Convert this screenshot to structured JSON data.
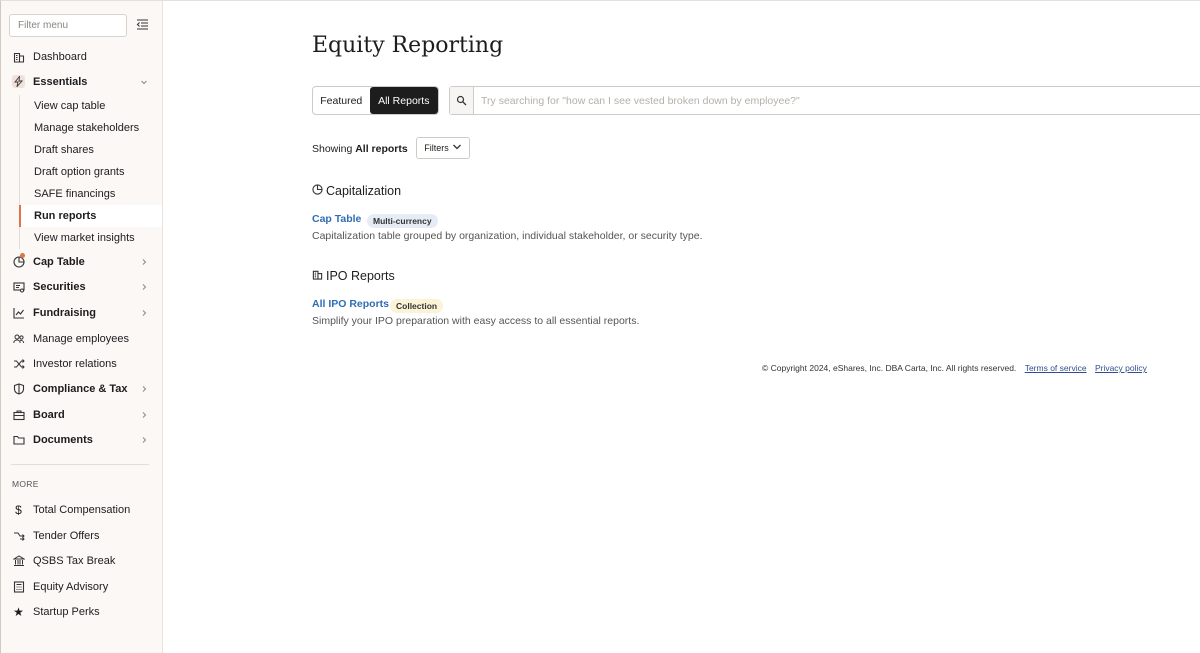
{
  "sidebar": {
    "filter_placeholder": "Filter menu",
    "items": [
      {
        "label": "Dashboard",
        "icon": "building-icon"
      },
      {
        "label": "Essentials",
        "icon": "bolt-icon"
      },
      {
        "label": "Cap Table",
        "icon": "pie-chart-icon"
      },
      {
        "label": "Securities",
        "icon": "certificate-icon"
      },
      {
        "label": "Fundraising",
        "icon": "growth-chart-icon"
      },
      {
        "label": "Manage employees",
        "icon": "people-icon"
      },
      {
        "label": "Investor relations",
        "icon": "shuffle-icon"
      },
      {
        "label": "Compliance & Tax",
        "icon": "shield-icon"
      },
      {
        "label": "Board",
        "icon": "briefcase-icon"
      },
      {
        "label": "Documents",
        "icon": "folder-icon"
      }
    ],
    "essentials_sub": [
      {
        "label": "View cap table"
      },
      {
        "label": "Manage stakeholders"
      },
      {
        "label": "Draft shares"
      },
      {
        "label": "Draft option grants"
      },
      {
        "label": "SAFE financings"
      },
      {
        "label": "Run reports"
      },
      {
        "label": "View market insights"
      }
    ],
    "more_label": "MORE",
    "more_items": [
      {
        "label": "Total Compensation",
        "icon": "dollar-icon"
      },
      {
        "label": "Tender Offers",
        "icon": "tender-icon"
      },
      {
        "label": "QSBS Tax Break",
        "icon": "bank-icon"
      },
      {
        "label": "Equity Advisory",
        "icon": "calculator-icon"
      },
      {
        "label": "Startup Perks",
        "icon": "star-icon"
      }
    ]
  },
  "main": {
    "title": "Equity Reporting",
    "tabs": {
      "featured": "Featured",
      "all": "All Reports"
    },
    "search_placeholder": "Try searching for \"how can I see vested broken down by employee?\"",
    "showing_prefix": "Showing",
    "showing_value": "All reports",
    "filters_label": "Filters",
    "sections": [
      {
        "heading": "Capitalization",
        "icon": "pie-chart-icon",
        "reports": [
          {
            "name": "Cap Table",
            "tag": "Multi-currency",
            "description": "Capitalization table grouped by organization, individual stakeholder, or security type."
          }
        ]
      },
      {
        "heading": "IPO Reports",
        "icon": "building-icon",
        "reports": [
          {
            "name": "All IPO Reports",
            "tag": "Collection",
            "description": "Simplify your IPO preparation with easy access to all essential reports."
          }
        ]
      }
    ],
    "footer": {
      "copyright": "© Copyright 2024, eShares, Inc. DBA Carta, Inc. All rights reserved.",
      "terms": "Terms of service",
      "privacy": "Privacy policy"
    }
  },
  "colors": {
    "accent": "#e0734c",
    "link": "#2f6db4",
    "sidebar_bg": "#fbf8f6"
  }
}
